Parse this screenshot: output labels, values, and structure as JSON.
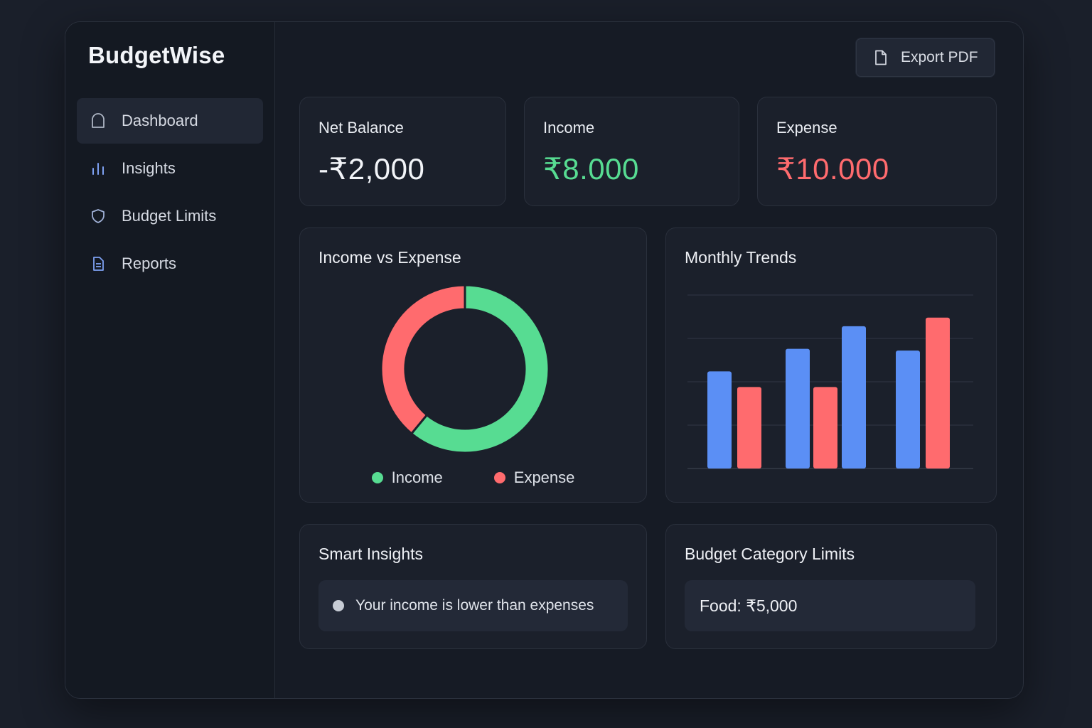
{
  "app": {
    "brand": "BudgetWise"
  },
  "sidebar": {
    "items": [
      {
        "label": "Dashboard",
        "icon": "home-icon",
        "active": true
      },
      {
        "label": "Insights",
        "icon": "bar-chart-icon",
        "active": false
      },
      {
        "label": "Budget Limits",
        "icon": "shield-icon",
        "active": false
      },
      {
        "label": "Reports",
        "icon": "document-icon",
        "active": false
      }
    ]
  },
  "header": {
    "export_label": "Export PDF",
    "export_icon": "file-icon"
  },
  "summary": {
    "net_balance": {
      "label": "Net Balance",
      "value": "-₹2,000",
      "color": "#f2f4f8"
    },
    "income": {
      "label": "Income",
      "value": "₹8.000",
      "color": "#57dc92"
    },
    "expense": {
      "label": "Expense",
      "value": "₹10.000",
      "color": "#ff6b6e"
    }
  },
  "donut": {
    "title": "Income vs Expense",
    "legend": [
      {
        "label": "Income",
        "color": "#57dc92"
      },
      {
        "label": "Expense",
        "color": "#ff6b6e"
      }
    ]
  },
  "trends": {
    "title": "Monthly Trends"
  },
  "insights": {
    "title": "Smart Insights",
    "items": [
      "Your income is lower than expenses"
    ]
  },
  "limits": {
    "title": "Budget Category Limits",
    "items": [
      "Food: ₹5,000"
    ]
  },
  "colors": {
    "income": "#57dc92",
    "expense": "#ff6b6e",
    "bar_blue": "#5b8ff5",
    "bar_red": "#ff6b6e"
  },
  "chart_data": [
    {
      "type": "pie",
      "title": "Income vs Expense",
      "categories": [
        "Income",
        "Expense"
      ],
      "values": [
        61,
        39
      ]
    },
    {
      "type": "bar",
      "title": "Monthly Trends",
      "bars": [
        {
          "series": "blue",
          "value": 56
        },
        {
          "series": "red",
          "value": 47
        },
        {
          "series": "blue",
          "value": 69
        },
        {
          "series": "red",
          "value": 47
        },
        {
          "series": "blue",
          "value": 82
        },
        {
          "series": "blue",
          "value": 68
        },
        {
          "series": "red",
          "value": 87
        }
      ],
      "ylim": [
        0,
        100
      ],
      "grid": true
    }
  ]
}
